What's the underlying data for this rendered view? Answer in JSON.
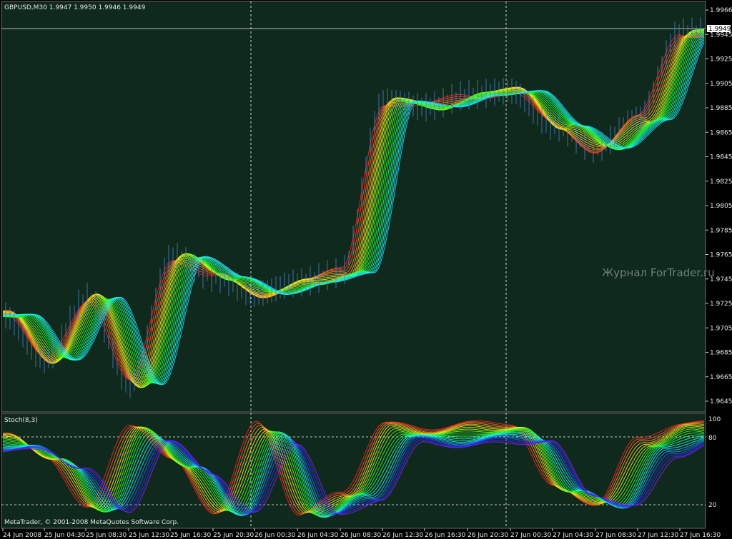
{
  "app": "MetaTrader",
  "chart": {
    "header": "GBPUSD,M30  1.9947 1.9950 1.9946 1.9949",
    "symbol": "GBPUSD",
    "timeframe": "M30",
    "ohlc": {
      "open": "1.9947",
      "high": "1.9950",
      "low": "1.9946",
      "close": "1.9949"
    },
    "current_price_label": "1.9949",
    "watermark": "Журнал ForTrader.ru",
    "colors": {
      "background": "#0f2a1d",
      "grid": "#c8c8c8",
      "axis_text": "#e6e6e6"
    },
    "price_axis_labels": [
      "1.9966",
      "1.9945",
      "1.9925",
      "1.9905",
      "1.9885",
      "1.9865",
      "1.9845",
      "1.9825",
      "1.9805",
      "1.9785",
      "1.9765",
      "1.9745",
      "1.9725",
      "1.9705",
      "1.9685",
      "1.9665",
      "1.9645"
    ]
  },
  "indicator": {
    "name": "Stoch(8,3)",
    "levels_labels": [
      "100",
      "80",
      "20"
    ],
    "copyright": "MetaTrader, © 2001-2008 MetaQuotes Software Corp."
  },
  "time_axis_labels": [
    "24 Jun 2008",
    "25 Jun 04:30",
    "25 Jun 08:30",
    "25 Jun 12:30",
    "25 Jun 16:30",
    "25 Jun 20:30",
    "26 Jun 00:30",
    "26 Jun 04:30",
    "26 Jun 08:30",
    "26 Jun 12:30",
    "26 Jun 16:30",
    "26 Jun 20:30",
    "27 Jun 00:30",
    "27 Jun 04:30",
    "27 Jun 08:30",
    "27 Jun 12:30",
    "27 Jun 16:30"
  ],
  "chart_data": {
    "type": "line",
    "title": "GBPUSD,M30",
    "ylim": [
      1.964,
      1.997
    ],
    "x": [
      "24 Jun 2008",
      "25 Jun 04:30",
      "25 Jun 08:30",
      "25 Jun 12:30",
      "25 Jun 16:30",
      "25 Jun 20:30",
      "26 Jun 00:30",
      "26 Jun 04:30",
      "26 Jun 08:30",
      "26 Jun 12:30",
      "26 Jun 16:30",
      "26 Jun 20:30",
      "27 Jun 00:30",
      "27 Jun 04:30",
      "27 Jun 08:30",
      "27 Jun 12:30",
      "27 Jun 16:30"
    ],
    "series": [
      {
        "values": [
          1.9718,
          1.9682,
          1.9732,
          1.9662,
          1.9765,
          1.9748,
          1.9735,
          1.9744,
          1.9752,
          1.989,
          1.9885,
          1.9895,
          1.9898,
          1.987,
          1.9852,
          1.9875,
          1.9945
        ]
      }
    ],
    "stochastic": {
      "name": "Stoch(8,3)",
      "ylim": [
        0,
        100
      ],
      "levels": [
        80,
        20
      ],
      "values": [
        85,
        65,
        15,
        95,
        60,
        12,
        95,
        10,
        30,
        95,
        90,
        95,
        95,
        35,
        20,
        80,
        95
      ]
    }
  }
}
